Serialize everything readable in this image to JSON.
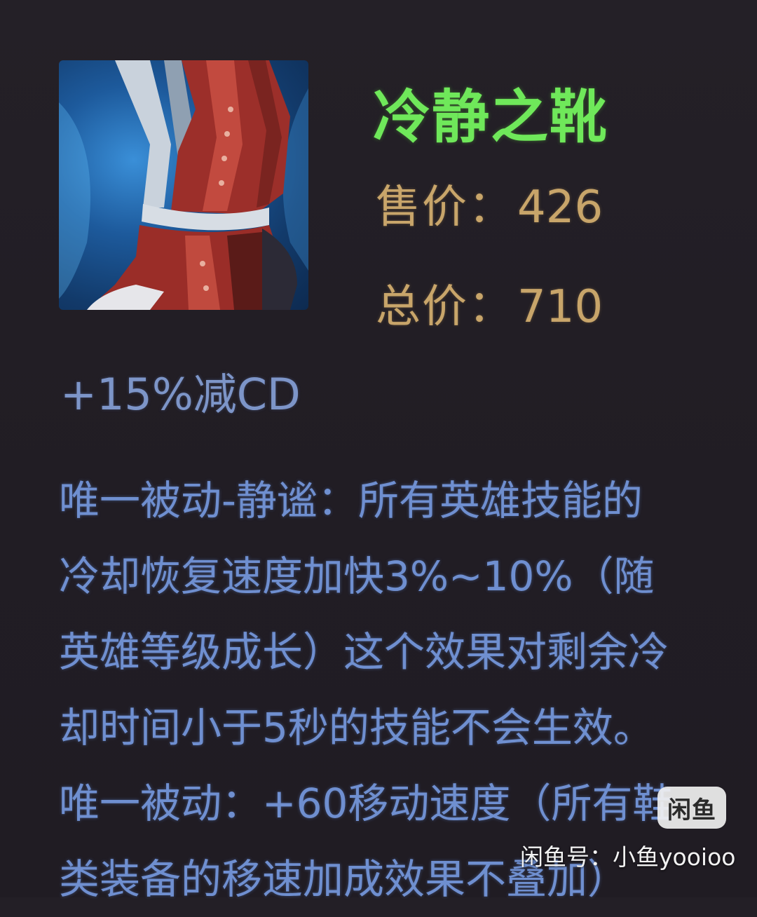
{
  "item": {
    "name": "冷静之靴",
    "sell_label": "售价：",
    "sell_value": "426",
    "total_label": "总价：",
    "total_value": "710",
    "stat": "+15%减CD",
    "icon": "boot-icon"
  },
  "description": {
    "lines": [
      "唯一被动-静谧：所有英雄技能的",
      "冷却恢复速度加快3%~10%（随",
      "英雄等级成长）这个效果对剩余冷",
      "却时间小于5秒的技能不会生效。",
      "唯一被动：+60移动速度（所有鞋",
      "类装备的移速加成效果不叠加）"
    ]
  },
  "watermark": {
    "badge": "闲鱼",
    "text": "闲鱼号：小鱼yooioo"
  },
  "colors": {
    "background": "#231f26",
    "name": "#6fe85a",
    "price": "#c8a56a",
    "stat": "#7d95c8",
    "description": "#6f8fd0"
  }
}
